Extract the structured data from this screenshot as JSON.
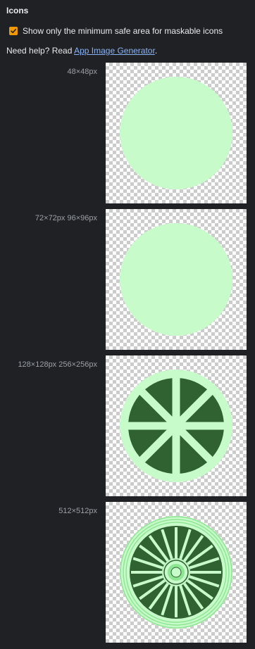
{
  "section": {
    "title": "Icons"
  },
  "checkbox": {
    "label": "Show only the minimum safe area for maskable icons",
    "checked": true
  },
  "help": {
    "prefix": "Need help? Read ",
    "link": "App Image Generator",
    "suffix": "."
  },
  "icons": [
    {
      "label": "48×48px",
      "content": "plain-circle"
    },
    {
      "label": "72×72px 96×96px",
      "content": "plain-circle"
    },
    {
      "label": "128×128px 256×256px",
      "content": "wheel-8-spokes"
    },
    {
      "label": "512×512px",
      "content": "wheel-detailed"
    }
  ],
  "colors": {
    "background": "#202124",
    "mint": "#c7fbca",
    "dark_green": "#2f6131",
    "mid_green": "#8ee692",
    "checkbox_accent": "#f29900",
    "link": "#8ab4f8"
  }
}
